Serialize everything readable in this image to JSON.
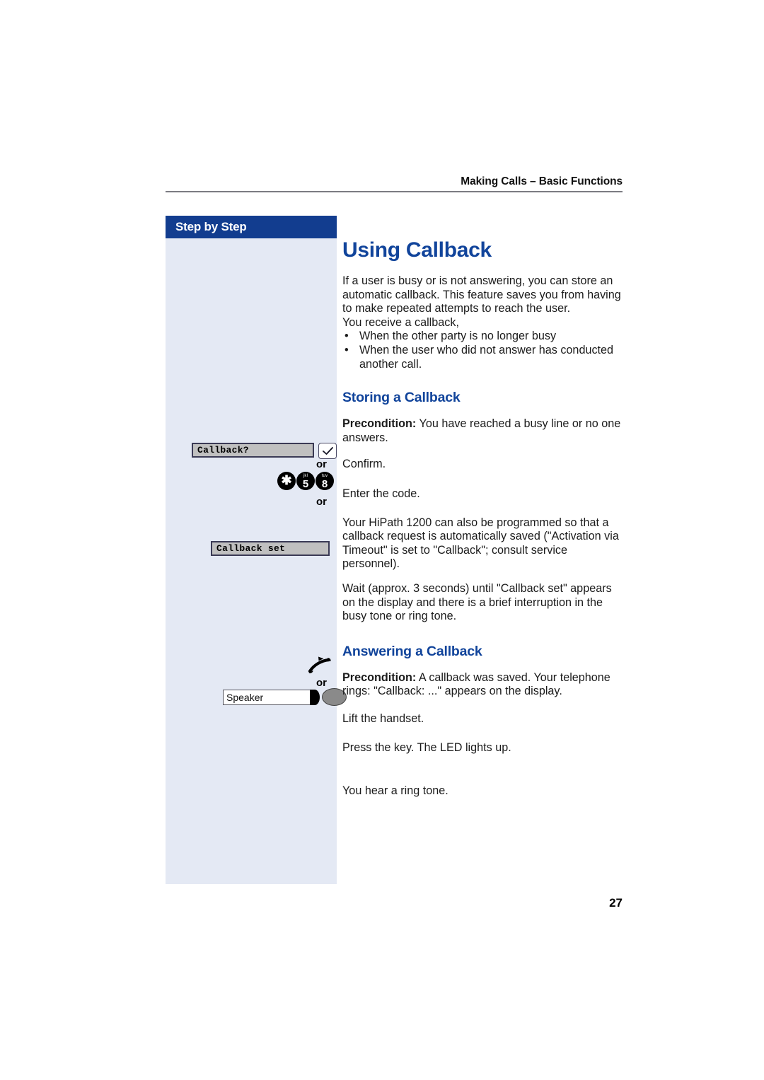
{
  "header": {
    "running_title": "Making Calls – Basic Functions"
  },
  "sidebar": {
    "title": "Step by Step",
    "widgets": {
      "callback_softkey": {
        "display_text": "Callback?",
        "key_icon": "checkmark-key-icon",
        "or_label": "or"
      },
      "dial_code": {
        "keys": [
          {
            "glyph": "✱",
            "letters": ""
          },
          {
            "glyph": "5",
            "letters": "jkl"
          },
          {
            "glyph": "8",
            "letters": "tuv"
          }
        ],
        "or_label": "or"
      },
      "callback_set_display": {
        "display_text": "Callback set"
      },
      "handset": {
        "icon": "lift-handset-icon",
        "or_label": "or"
      },
      "speaker_key": {
        "label": "Speaker",
        "led_icon": "led-indicator-icon"
      }
    }
  },
  "main": {
    "title": "Using Callback",
    "intro": {
      "paragraph": "If a user is busy or is not answering, you can store an automatic callback. This feature saves you from having to make repeated attempts to reach the user.",
      "lead_in": "You receive a callback,",
      "bullets": [
        "When the other party is no longer busy",
        "When the user who did not answer has conducted another call."
      ],
      "bullet_char": "•"
    },
    "sections": [
      {
        "heading": "Storing a Callback",
        "precondition_label": "Precondition:",
        "precondition_text": " You have reached a busy line or no one answers.",
        "steps": [
          "Confirm.",
          "Enter the code.",
          "Your HiPath 1200 can also be programmed so that a callback request is automatically saved (\"Activation via Timeout\" is set to \"Callback\"; consult service personnel).",
          "Wait (approx. 3 seconds) until \"Callback set\" appears on the display and there is a brief interruption in the busy tone or ring tone."
        ]
      },
      {
        "heading": "Answering a Callback",
        "precondition_label": "Precondition:",
        "precondition_text": " A callback was saved. Your telephone rings: \"Callback: ...\" appears on the display.",
        "steps": [
          "Lift the handset.",
          "Press the key. The LED lights up.",
          "You hear a ring tone."
        ]
      }
    ]
  },
  "footer": {
    "page_number": "27"
  },
  "colors": {
    "accent_blue": "#11449b",
    "sidebar_header": "#123d8f",
    "sidebar_bg": "#e4e9f4",
    "display_grey": "#c0c0c0"
  }
}
